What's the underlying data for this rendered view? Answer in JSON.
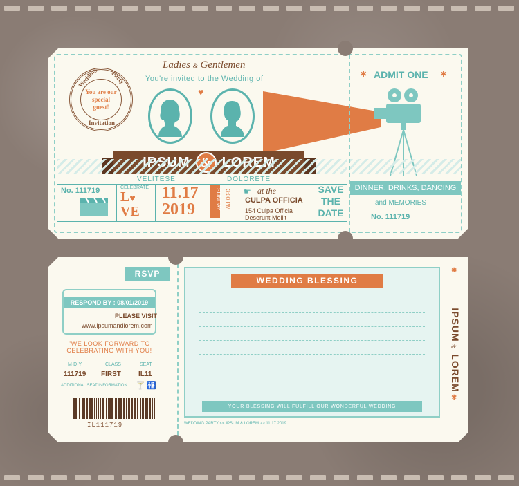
{
  "colors": {
    "background": "#8a7c74",
    "ticket": "#fbf9ef",
    "teal": "#5bb3ad",
    "orange": "#e07c45",
    "brown": "#7a4a2c"
  },
  "top": {
    "stamp": {
      "ring_top_left": "Wedding",
      "ring_top_right": "Party",
      "ring_bottom": "Invitation",
      "center": "You are our special guest!"
    },
    "greeting": "Ladies",
    "greeting_amp": "&",
    "greeting2": "Gentlemen",
    "invite_line": "You're invited to the Wedding of",
    "ribbon": {
      "bride": "IPSUM",
      "amp": "&",
      "groom": "LOREM"
    },
    "bride_surname": "VELITESE",
    "groom_surname": "DOLORETE",
    "ticket_no": "No. 111719",
    "celebrate": "CELEBRATE",
    "love_l": "L",
    "love_v": "V",
    "love_e": "E",
    "date": "11.17",
    "year": "2019",
    "weekday": "SUNDAY",
    "time": "3:00 PM",
    "venue_at": "at the",
    "venue": "CULPA OFFICIA",
    "address1": "154 Culpa Officia",
    "address2": "Deserunt Mollit",
    "save1": "SAVE",
    "save2": "THE",
    "save3": "DATE",
    "stub": {
      "admit": "ADMIT ONE",
      "activities": "DINNER, DRINKS, DANCING",
      "memories": "and MEMORIES",
      "no": "No. 111719"
    }
  },
  "bottom": {
    "rsvp": "RSVP",
    "respond": "RESPOND BY : 08/01/2019",
    "please_visit": "PLEASE VISIT",
    "url": "www.ipsumandlorem.com",
    "quote1": "\"WE LOOK FORWARD TO",
    "quote2": "CELEBRATING WITH YOU!",
    "table": {
      "headers": [
        "M-D-Y",
        "CLASS",
        "SEAT"
      ],
      "values": [
        "111719",
        "FIRST",
        "IL11"
      ]
    },
    "additional": "ADDITIONAL SEAT INFORMATION",
    "barcode_code": "IL111719",
    "blessing_title": "WEDDING BLESSING",
    "blessing_footer": "YOUR BLESSING WILL FULFILL OUR WONDERFUL WEDDING",
    "fine_print": "WEDDING PARTY << IPSUM & LOREM >> 11.17.2019",
    "side_name1": "IPSUM",
    "side_amp": "&",
    "side_name2": "LOREM"
  },
  "icons": [
    "heart-icon",
    "movie-projector-icon",
    "clapperboard-icon",
    "hand-pointer-icon",
    "cocktail-icon",
    "restroom-icon",
    "star-icon",
    "barcode"
  ]
}
